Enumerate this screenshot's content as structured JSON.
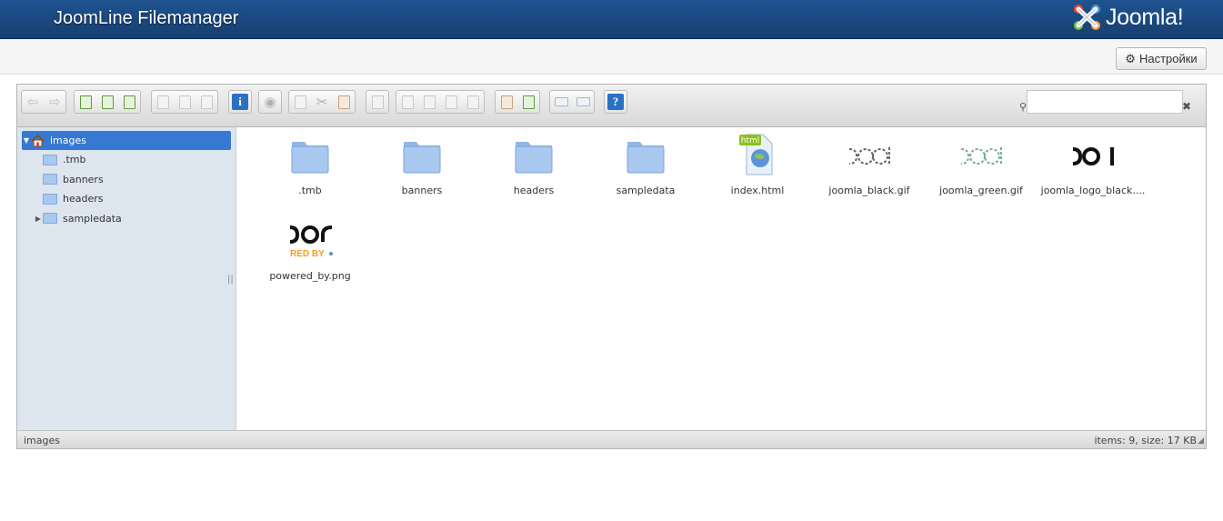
{
  "header": {
    "title": "JoomLine Filemanager",
    "brand": "Joomla!"
  },
  "subbar": {
    "settings_label": "Настройки"
  },
  "search": {
    "placeholder": "",
    "value": ""
  },
  "tree": {
    "root": "images",
    "items": [
      {
        "label": ".tmb",
        "expandable": false
      },
      {
        "label": "banners",
        "expandable": false
      },
      {
        "label": "headers",
        "expandable": false
      },
      {
        "label": "sampledata",
        "expandable": true
      }
    ]
  },
  "files": [
    {
      "name": ".tmb",
      "kind": "folder"
    },
    {
      "name": "banners",
      "kind": "folder"
    },
    {
      "name": "headers",
      "kind": "folder"
    },
    {
      "name": "sampledata",
      "kind": "folder"
    },
    {
      "name": "index.html",
      "kind": "html",
      "badge": "html"
    },
    {
      "name": "joomla_black.gif",
      "kind": "image-outline-black"
    },
    {
      "name": "joomla_green.gif",
      "kind": "image-outline-green"
    },
    {
      "name": "joomla_logo_black....",
      "kind": "image-solid-black"
    },
    {
      "name": "powered_by.png",
      "kind": "image-powered",
      "caption": "RED BY"
    }
  ],
  "status": {
    "path": "images",
    "info": "items: 9, size: 17 KB"
  },
  "colors": {
    "header": "#1f5390",
    "selected": "#3679d2",
    "folder": "#a9c8ef",
    "tree_bg": "#dde5ef"
  }
}
